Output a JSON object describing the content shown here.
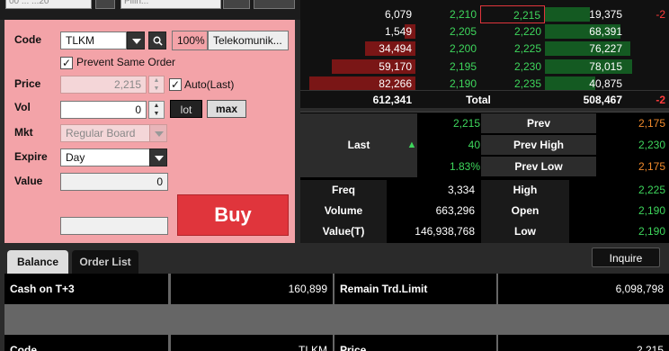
{
  "top": {
    "input1": "00 ... ...20",
    "input2": "Pilih...",
    "input3": ""
  },
  "order": {
    "code_label": "Code",
    "code_value": "TLKM",
    "pct": "100%",
    "company": "Telekomunik...",
    "prevent_label": "Prevent Same Order",
    "prevent_checked": "✓",
    "price_label": "Price",
    "price_value": "2,215",
    "auto_label": "Auto(Last)",
    "auto_checked": "✓",
    "vol_label": "Vol",
    "vol_value": "0",
    "lot_label": "lot",
    "max_label": "max",
    "mkt_label": "Mkt",
    "mkt_value": "Regular Board",
    "expire_label": "Expire",
    "expire_value": "Day",
    "value_label": "Value",
    "value_value": "0",
    "buy_label": "Buy"
  },
  "book": {
    "rows": [
      {
        "bidvol": "6,079",
        "bid": "2,210",
        "offer": "2,215",
        "offervol": "19,375",
        "ch": "-2",
        "bidbar": 0,
        "offbar": 0.45
      },
      {
        "bidvol": "1,549",
        "bid": "2,205",
        "offer": "2,220",
        "offervol": "68,391",
        "ch": "",
        "bidbar": 0.1,
        "offbar": 0.75
      },
      {
        "bidvol": "34,494",
        "bid": "2,200",
        "offer": "2,225",
        "offervol": "76,227",
        "ch": "",
        "bidbar": 0.45,
        "offbar": 0.85
      },
      {
        "bidvol": "59,170",
        "bid": "2,195",
        "offer": "2,230",
        "offervol": "78,015",
        "ch": "",
        "bidbar": 0.75,
        "offbar": 0.87
      },
      {
        "bidvol": "82,266",
        "bid": "2,190",
        "offer": "2,235",
        "offervol": "40,875",
        "ch": "",
        "bidbar": 0.95,
        "offbar": 0.5
      }
    ],
    "total_bid": "612,341",
    "total_label": "Total",
    "total_offer": "508,467",
    "total_ch": "-2"
  },
  "stats": {
    "last_label": "Last",
    "last": "2,215",
    "change": "40",
    "change_pct": "1.83%",
    "prev_label": "Prev",
    "prev": "2,175",
    "prevhigh_label": "Prev High",
    "prevhigh": "2,230",
    "prevlow_label": "Prev Low",
    "prevlow": "2,175",
    "freq_label": "Freq",
    "freq": "3,334",
    "high_label": "High",
    "high": "2,225",
    "volume_label": "Volume",
    "volume": "663,296",
    "open_label": "Open",
    "open": "2,190",
    "valuet_label": "Value(T)",
    "valuet": "146,938,768",
    "low_label": "Low",
    "low": "2,190"
  },
  "tabs": {
    "balance": "Balance",
    "orderlist": "Order List",
    "inquire": "Inquire"
  },
  "balance": {
    "cash_label": "Cash on T+3",
    "cash": "160,899",
    "remain_label": "Remain Trd.Limit",
    "remain": "6,098,798",
    "code_label": "Code",
    "code": "TLKM",
    "price_label": "Price",
    "price": "2,215"
  },
  "colors": {
    "panel": "#f3a3a8",
    "buy": "#e0353c",
    "up": "#3ed65c",
    "down": "#ff3b3b",
    "prev": "#f08a2c"
  }
}
